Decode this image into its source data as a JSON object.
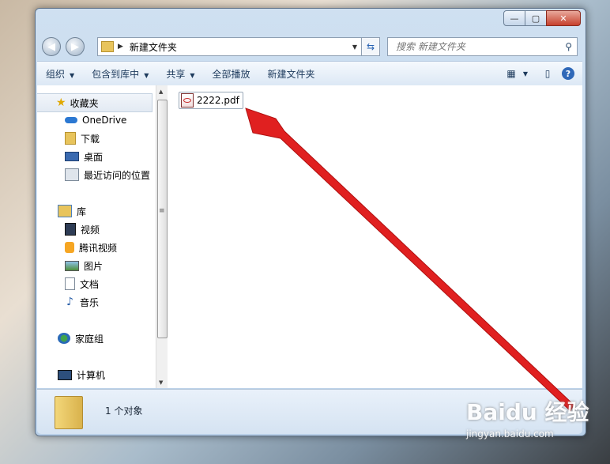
{
  "window": {
    "caption_min": "—",
    "caption_max": "▢",
    "caption_close": "✕"
  },
  "address": {
    "path": "新建文件夹"
  },
  "search": {
    "placeholder": "搜索 新建文件夹"
  },
  "toolbar": {
    "organize": "组织",
    "include_in_library": "包含到库中",
    "share": "共享",
    "play_all": "全部播放",
    "new_folder": "新建文件夹"
  },
  "navpane": {
    "favorites": "收藏夹",
    "onedrive": "OneDrive",
    "downloads": "下载",
    "desktop": "桌面",
    "recent": "最近访问的位置",
    "libraries": "库",
    "videos": "视频",
    "tencent_video": "腾讯视频",
    "pictures": "图片",
    "documents": "文档",
    "music": "音乐",
    "homegroup": "家庭组",
    "computer": "计算机"
  },
  "content": {
    "files": [
      {
        "name": "2222.pdf"
      }
    ]
  },
  "status": {
    "count": "1 个对象"
  },
  "watermark": {
    "brand": "Baidu 经验",
    "url": "jingyan.baidu.com"
  },
  "colors": {
    "arrow": "#e02020",
    "accent": "#2f68b8"
  }
}
